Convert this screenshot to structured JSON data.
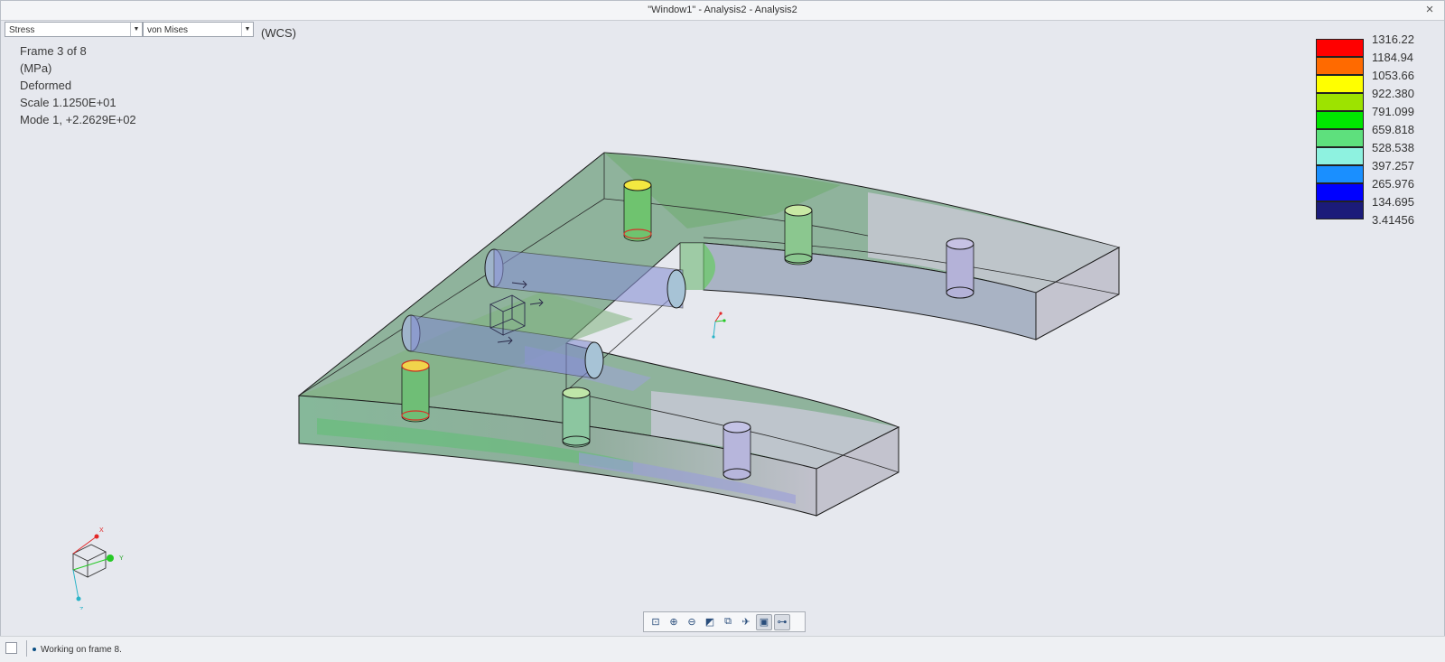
{
  "window": {
    "title": "\"Window1\" - Analysis2 - Analysis2",
    "close_glyph": "×"
  },
  "controls": {
    "quantity_select": "Stress",
    "component_select": "von Mises",
    "coord_system": "(WCS)"
  },
  "info": {
    "frame": "Frame 3 of 8",
    "units": "(MPa)",
    "display": "Deformed",
    "scale": "Scale  1.1250E+01",
    "mode": "Mode 1,  +2.2629E+02"
  },
  "legend": [
    {
      "value": "1316.22",
      "color": "#ff0000"
    },
    {
      "value": "1184.94",
      "color": "#ff6a00"
    },
    {
      "value": "1053.66",
      "color": "#ffff00"
    },
    {
      "value": "922.380",
      "color": "#9de300"
    },
    {
      "value": "791.099",
      "color": "#00e600"
    },
    {
      "value": "659.818",
      "color": "#5ee07d"
    },
    {
      "value": "528.538",
      "color": "#8ef2e0"
    },
    {
      "value": "397.257",
      "color": "#1a8fff"
    },
    {
      "value": "265.976",
      "color": "#0000ff"
    },
    {
      "value": "134.695",
      "color": "#1b1b7a"
    },
    {
      "value": "3.41456",
      "color": ""
    }
  ],
  "triad_labels": {
    "x": "X",
    "y": "Y",
    "z": "Z"
  },
  "toolbar": [
    {
      "name": "refit-icon",
      "glyph": "⊡"
    },
    {
      "name": "zoom-in-icon",
      "glyph": "⊕"
    },
    {
      "name": "zoom-out-icon",
      "glyph": "⊖"
    },
    {
      "name": "shading-icon",
      "glyph": "◩"
    },
    {
      "name": "saved-views-icon",
      "glyph": "⧉"
    },
    {
      "name": "datum-display-icon",
      "glyph": "✈"
    },
    {
      "name": "annotation-display-icon",
      "glyph": "▣"
    },
    {
      "name": "spin-center-icon",
      "glyph": "⊶"
    }
  ],
  "status": {
    "message": "Working on frame 8."
  }
}
